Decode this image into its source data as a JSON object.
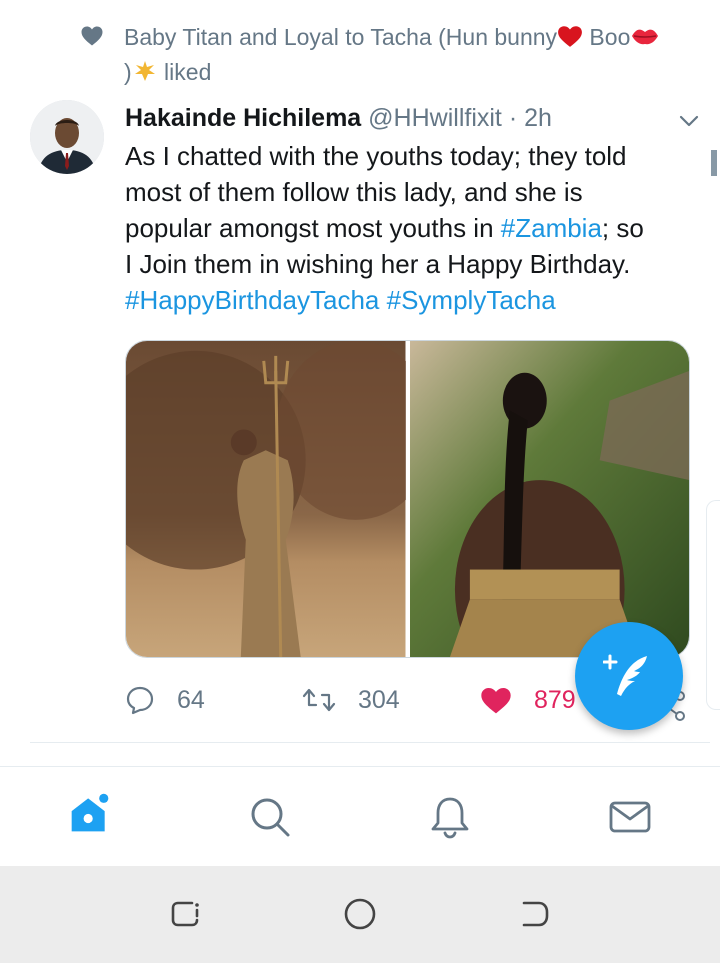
{
  "social_context": {
    "text": "Baby Titan and Loyal to Tacha (Hun bunny",
    "boo": " Boo",
    "close_paren": ")",
    "liked": " liked"
  },
  "tweet": {
    "name": "Hakainde Hichilema",
    "handle": "@HHwillfixit",
    "separator": "·",
    "time": "2h",
    "text_lines": {
      "l1": "As I chatted with the youths today; they told",
      "l2": "most of them follow this lady, and she is",
      "l3_pre": "popular amongst most youths in ",
      "l3_link": "#Zambia",
      "l3_post": "; so",
      "l4": "I Join them in wishing her a Happy Birthday.",
      "tag1": "#HappyBirthdayTacha",
      "tag2": "#SymplyTacha"
    },
    "stats": {
      "replies": "64",
      "retweets": "304",
      "likes": "879"
    }
  },
  "colors": {
    "brand_blue": "#1da1f2",
    "link_blue": "#1b95e0",
    "like_red": "#e0245e",
    "gray": "#657786"
  },
  "icons": {
    "social_context": "heart-icon",
    "caret": "chevron-down-icon",
    "reply": "reply-icon",
    "retweet": "retweet-icon",
    "like": "heart-filled-icon",
    "share": "share-icon",
    "compose": "compose-tweet-icon",
    "tabs": [
      "home-icon",
      "search-icon",
      "notifications-bell-icon",
      "messages-envelope-icon"
    ],
    "system_nav": [
      "recents-icon",
      "home-circle-icon",
      "back-icon"
    ]
  }
}
